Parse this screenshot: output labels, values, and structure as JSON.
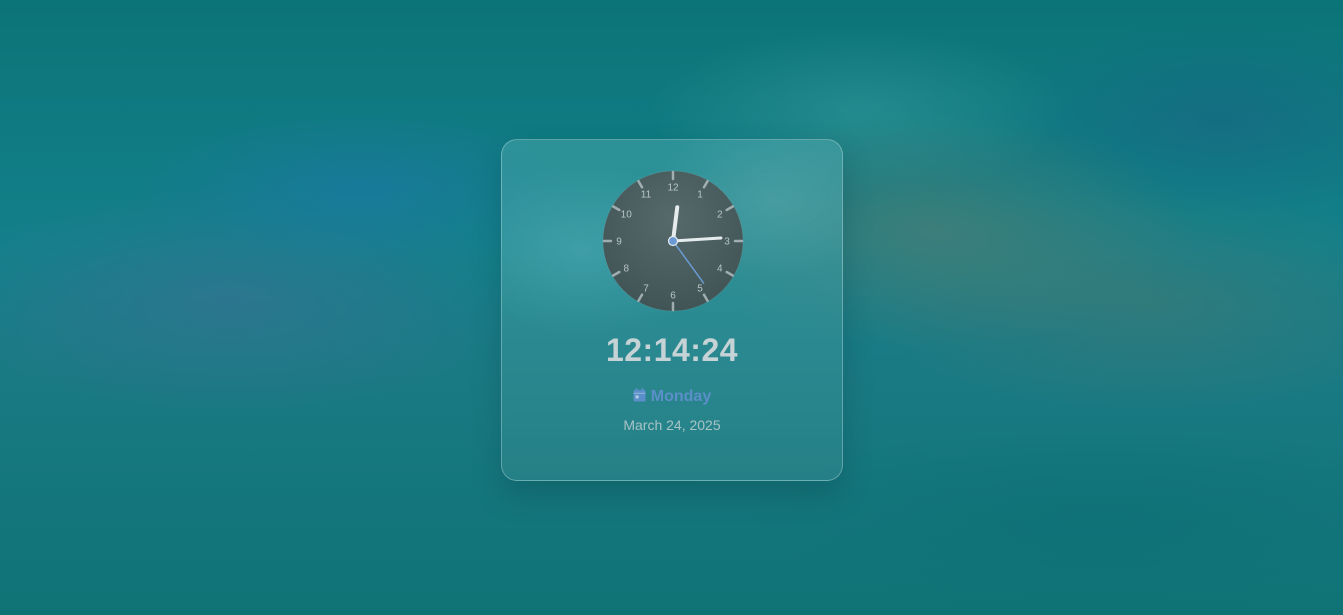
{
  "widget": {
    "time": "12:14:24",
    "day": "Monday",
    "date": "March 24, 2025",
    "day_icon": "calendar-icon"
  },
  "clock": {
    "hours": 12,
    "minutes": 14,
    "seconds": 24,
    "numerals": [
      "12",
      "1",
      "2",
      "3",
      "4",
      "5",
      "6",
      "7",
      "8",
      "9",
      "10",
      "11"
    ]
  },
  "colors": {
    "accent": "#5b8fc9",
    "time_text": "#c6d3d6",
    "date_text": "#a7c4c6",
    "face": "#4b6364",
    "second_hand": "#6b9ad4"
  }
}
